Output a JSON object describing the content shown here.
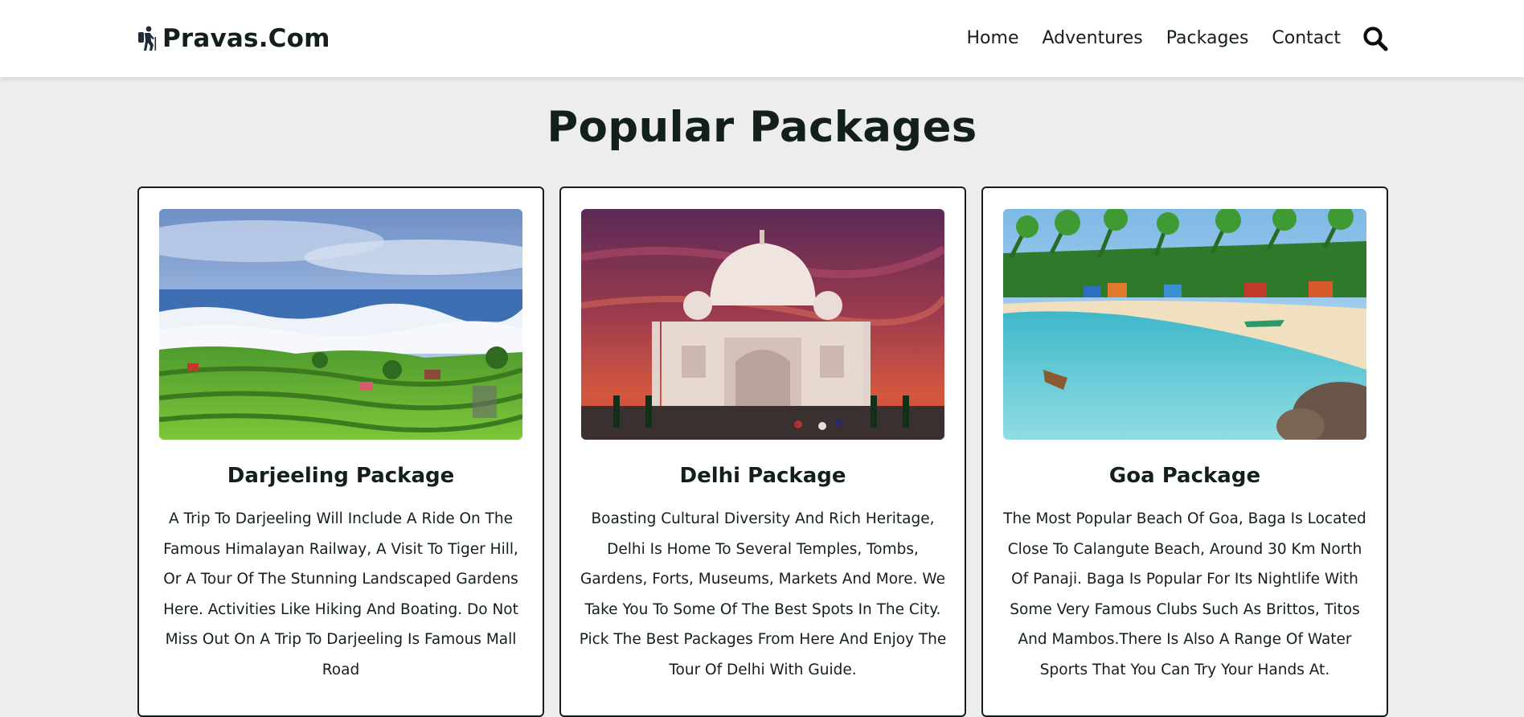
{
  "header": {
    "brand": "Pravas.Com",
    "nav": [
      "Home",
      "Adventures",
      "Packages",
      "Contact"
    ]
  },
  "packages": {
    "title": "Popular Packages",
    "cards": [
      {
        "title": "Darjeeling Package",
        "description": "A Trip To Darjeeling Will Include A Ride On The Famous Himalayan Railway, A Visit To Tiger Hill, Or A Tour Of The Stunning Landscaped Gardens Here. Activities Like Hiking And Boating. Do Not Miss Out On A Trip To Darjeeling Is Famous Mall Road"
      },
      {
        "title": "Delhi Package",
        "description": "Boasting Cultural Diversity And Rich Heritage, Delhi Is Home To Several Temples, Tombs, Gardens, Forts, Museums, Markets And More. We Take You To Some Of The Best Spots In The City. Pick The Best Packages From Here And Enjoy The Tour Of Delhi With Guide."
      },
      {
        "title": "Goa Package",
        "description": "The Most Popular Beach Of Goa, Baga Is Located Close To Calangute Beach, Around 30 Km North Of Panaji. Baga Is Popular For Its Nightlife With Some Very Famous Clubs Such As Brittos, Titos And Mambos.There Is Also A Range Of Water Sports That You Can Try Your Hands At."
      }
    ]
  }
}
